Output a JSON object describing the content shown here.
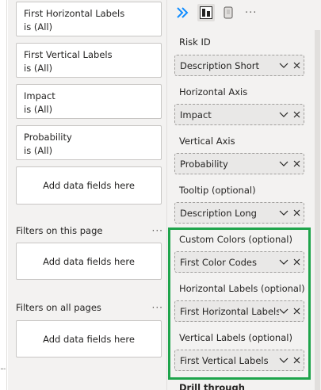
{
  "filters": {
    "visual_filters": [
      {
        "name": "First Horizontal Labels",
        "state": "is (All)"
      },
      {
        "name": "First Vertical Labels",
        "state": "is (All)"
      },
      {
        "name": "Impact",
        "state": "is (All)"
      },
      {
        "name": "Probability",
        "state": "is (All)"
      }
    ],
    "add_fields_label": "Add data fields here",
    "page_section": {
      "title": "Filters on this page",
      "more": "···",
      "add_fields_label": "Add data fields here"
    },
    "all_pages_section": {
      "title": "Filters on all pages",
      "more": "···",
      "add_fields_label": "Add data fields here"
    }
  },
  "visualizations": {
    "toolbar_more": "···",
    "wells": [
      {
        "label": "Risk ID",
        "field": "Description Short"
      },
      {
        "label": "Horizontal Axis",
        "field": "Impact"
      },
      {
        "label": "Vertical Axis",
        "field": "Probability"
      },
      {
        "label": "Tooltip (optional)",
        "field": "Description Long"
      },
      {
        "label": "Custom Colors (optional)",
        "field": "First Color Codes"
      },
      {
        "label": "Horizontal Labels (optional)",
        "field": "First Horizontal Labels"
      },
      {
        "label": "Vertical Labels (optional)",
        "field": "First Vertical Labels"
      }
    ],
    "drill_through": "Drill through"
  },
  "canvas": {
    "more": "···"
  },
  "colors": {
    "highlight": "#1ea44b",
    "pane_bg": "#f3f2f1",
    "accent": "#118dff"
  }
}
